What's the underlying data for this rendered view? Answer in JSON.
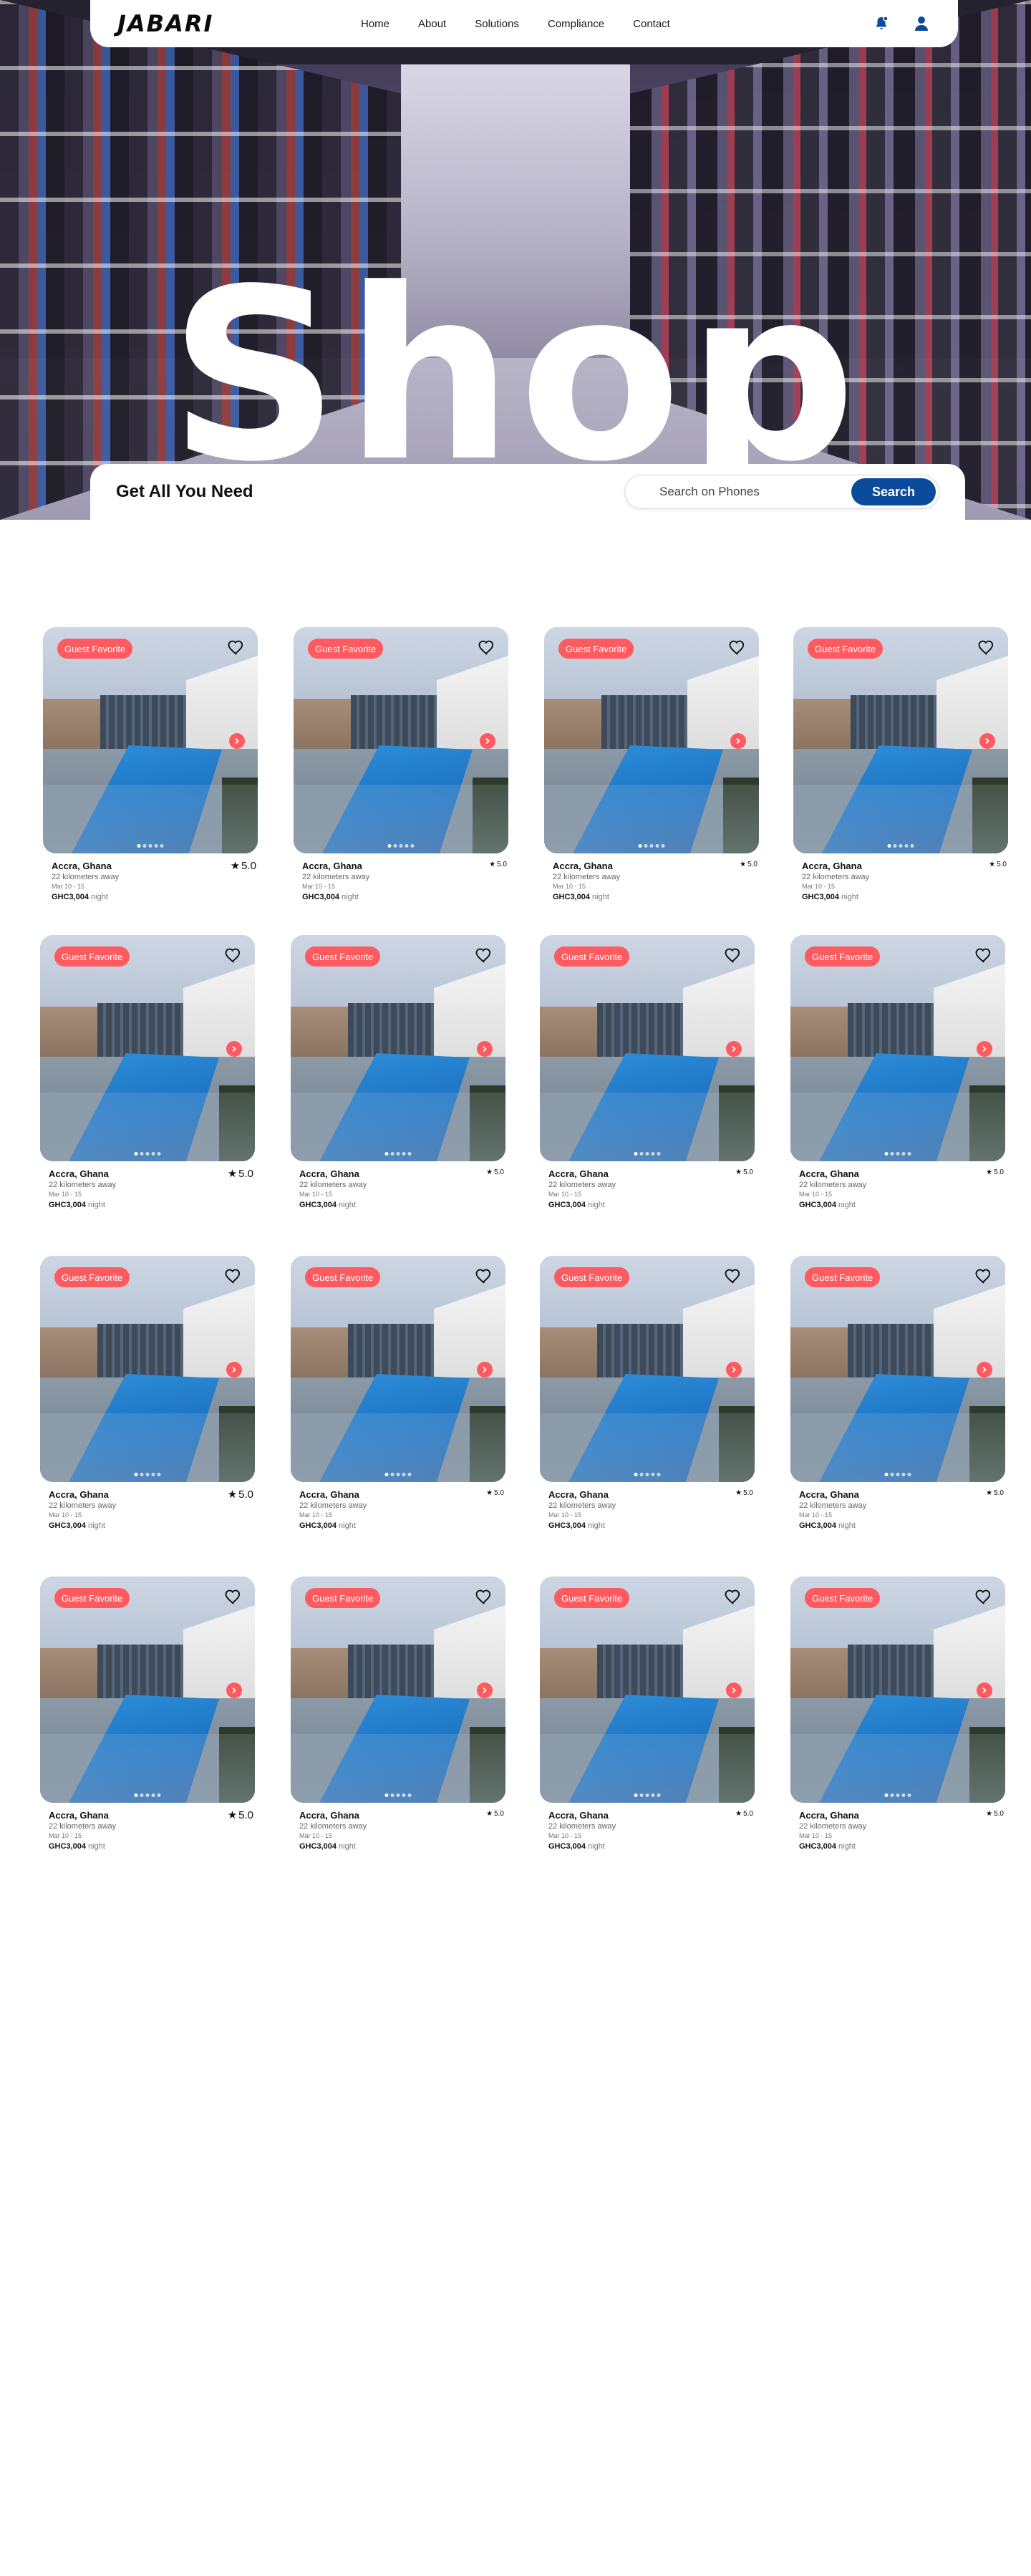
{
  "nav": {
    "logo": "JABARI",
    "links": [
      "Home",
      "About",
      "Solutions",
      "Compliance",
      "Contact"
    ]
  },
  "hero": {
    "word": "Shop"
  },
  "search": {
    "heading": "Get All You Need",
    "placeholder": "Search on Phones",
    "button": "Search"
  },
  "colors": {
    "accent": "#0a4b9b",
    "badge": "#ff5a5f"
  },
  "listing": {
    "badge": "Guest Favorite",
    "location": "Accra, Ghana",
    "distance": "22 kilometers away",
    "dates": "Mar 10 - 15",
    "price": "GHC3,004",
    "per": "night",
    "rating": "5.0"
  },
  "grid": {
    "rows": 4,
    "cols": 4
  }
}
